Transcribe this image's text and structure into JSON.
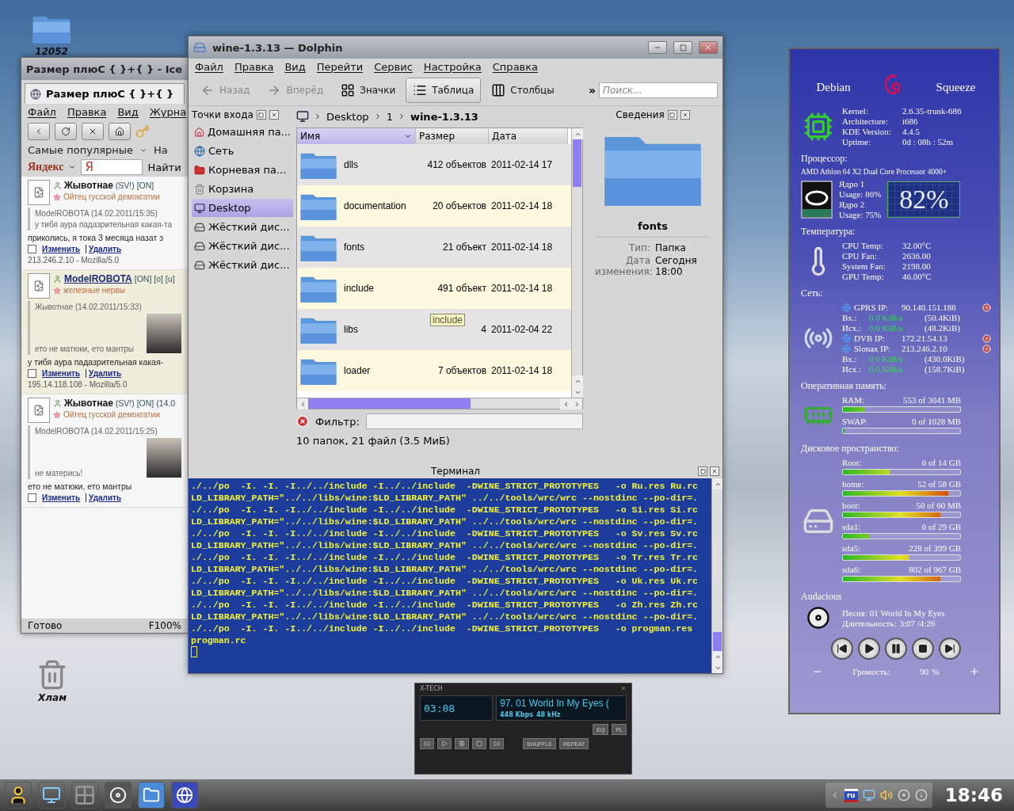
{
  "desktop_folder": {
    "label": "12052"
  },
  "desktop_trash": {
    "label": "Хлам"
  },
  "browser": {
    "title": "Размер плюС { }+{ } - Ice",
    "tab": "Размер плюС { }+{ }",
    "menu": [
      "Файл",
      "Правка",
      "Вид",
      "Журна"
    ],
    "bookmarks": [
      "Самые популярные",
      "На"
    ],
    "search_engine": "Яндекс",
    "search_value": "Я",
    "search_button": "Найти",
    "status": "Готово",
    "zoom": "F100%",
    "posts": [
      {
        "author": "Жывотнае",
        "tags": "(SV!) [ON]",
        "rank": "Ойтец гусской демокгатии",
        "quote_author": "ModelROBOTA (14.02.2011/15:35)",
        "quote_text": "у тибя аура падазрительная какая-та",
        "has_photo": false,
        "highlighted": false,
        "message": "приколись, я тока 3 месяца назат з",
        "links": [
          "Изменить",
          "Удалить"
        ],
        "meta": "213.246.2.10 - Mozilla/5.0"
      },
      {
        "author": "ModelROBOTA",
        "tags": "[ON] [o] [u]",
        "rank": "железные нервы",
        "quote_author": "Жывотнае (14.02.2011/15:33)",
        "quote_text": "ето не матюки, ето мантры",
        "has_photo": true,
        "highlighted": true,
        "message": "у тибя аура падазрительная какая-",
        "links": [
          "Изменить",
          "Удалить"
        ],
        "meta": "195.14.118.108 - Mozilla/5.0"
      },
      {
        "author": "Жывотнае",
        "tags": "(SV!) [ON] (14.0",
        "rank": "Ойтец гусской демокгатии",
        "quote_author": "ModelROBOTA (14.02.2011/15:25)",
        "quote_text": "не матерись!",
        "has_photo": true,
        "highlighted": false,
        "message": "ето не матюки, ето мантры",
        "links": [
          "Изменить",
          "Удалить"
        ]
      }
    ]
  },
  "dolphin": {
    "title": "wine-1.3.13 — Dolphin",
    "menu": [
      "Файл",
      "Правка",
      "Вид",
      "Перейти",
      "Сервис",
      "Настройка",
      "Справка"
    ],
    "toolbar": [
      {
        "label": "Назад",
        "kind": "back",
        "disabled": true,
        "selected": false
      },
      {
        "label": "Вперёд",
        "kind": "forward",
        "disabled": true,
        "selected": false
      },
      {
        "label": "Значки",
        "kind": "icons",
        "disabled": false,
        "selected": false
      },
      {
        "label": "Таблица",
        "kind": "details",
        "disabled": false,
        "selected": true
      },
      {
        "label": "Столбцы",
        "kind": "columns",
        "disabled": false,
        "selected": false
      }
    ],
    "more": "»",
    "search_placeholder": "Поиск...",
    "places_title": "Точки входа",
    "places": [
      {
        "label": "Домашняя па...",
        "kind": "home",
        "selected": false
      },
      {
        "label": "Сеть",
        "kind": "network",
        "selected": false
      },
      {
        "label": "Корневая па...",
        "kind": "root",
        "selected": false
      },
      {
        "label": "Корзина",
        "kind": "trash",
        "selected": false
      },
      {
        "label": "Desktop",
        "kind": "desktop",
        "selected": true
      },
      {
        "label": "Жёсткий дис...",
        "kind": "disk",
        "selected": false
      },
      {
        "label": "Жёсткий дис...",
        "kind": "disk",
        "selected": false
      },
      {
        "label": "Жёсткий дис...",
        "kind": "disk",
        "selected": false
      }
    ],
    "breadcrumb": [
      "Desktop",
      "1",
      "wine-1.3.13"
    ],
    "columns": [
      "Имя",
      "Размер",
      "Дата"
    ],
    "rows": [
      {
        "name": "dlls",
        "size": "412 объектов",
        "date": "2011-02-14 17"
      },
      {
        "name": "documentation",
        "size": "20 объектов",
        "date": "2011-02-14 18"
      },
      {
        "name": "fonts",
        "size": "21 объект",
        "date": "2011-02-14 18"
      },
      {
        "name": "include",
        "size": "491 объект",
        "date": "2011-02-14 18"
      },
      {
        "name": "libs",
        "size": "4",
        "date": "2011-02-04 22"
      },
      {
        "name": "loader",
        "size": "7 объектов",
        "date": "2011-02-14 18"
      }
    ],
    "tooltip": "include",
    "filter_label": "Фильтр:",
    "status": "10 папок, 21 файл (3.5 МиБ)",
    "info_title": "Сведения",
    "info_name": "fonts",
    "info_fields": [
      {
        "label": "Тип:",
        "value": "Папка"
      },
      {
        "label": "Дата изменения:",
        "value": "Сегодня 18:00"
      }
    ]
  },
  "terminal": {
    "title": "Терминал",
    "lines": [
      "./../po  -I. -I. -I../../include -I../../include  -DWINE_STRICT_PROTOTYPES   -o Ru.res Ru.rc",
      "LD_LIBRARY_PATH=\"../../libs/wine:$LD_LIBRARY_PATH\" ../../tools/wrc/wrc --nostdinc --po-dir=.",
      "./../po  -I. -I. -I../../include -I../../include  -DWINE_STRICT_PROTOTYPES   -o Si.res Si.rc",
      "LD_LIBRARY_PATH=\"../../libs/wine:$LD_LIBRARY_PATH\" ../../tools/wrc/wrc --nostdinc --po-dir=.",
      "./../po  -I. -I. -I../../include -I../../include  -DWINE_STRICT_PROTOTYPES   -o Sv.res Sv.rc",
      "LD_LIBRARY_PATH=\"../../libs/wine:$LD_LIBRARY_PATH\" ../../tools/wrc/wrc --nostdinc --po-dir=.",
      "./../po  -I. -I. -I../../include -I../../include  -DWINE_STRICT_PROTOTYPES   -o Tr.res Tr.rc",
      "LD_LIBRARY_PATH=\"../../libs/wine:$LD_LIBRARY_PATH\" ../../tools/wrc/wrc --nostdinc --po-dir=.",
      "./../po  -I. -I. -I../../include -I../../include  -DWINE_STRICT_PROTOTYPES   -o Uk.res Uk.rc",
      "LD_LIBRARY_PATH=\"../../libs/wine:$LD_LIBRARY_PATH\" ../../tools/wrc/wrc --nostdinc --po-dir=.",
      "./../po  -I. -I. -I../../include -I../../include  -DWINE_STRICT_PROTOTYPES   -o Zh.res Zh.rc",
      "LD_LIBRARY_PATH=\"../../libs/wine:$LD_LIBRARY_PATH\" ../../tools/wrc/wrc --nostdinc --po-dir=.",
      "./../po  -I. -I. -I../../include -I../../include  -DWINE_STRICT_PROTOTYPES   -o progman.res",
      "progman.rc"
    ]
  },
  "sysmon": {
    "distro": "Debian",
    "release": "Squeeze",
    "system": [
      {
        "label": "Kernel:",
        "value": "2.6.35-trunk-686"
      },
      {
        "label": "Architecture:",
        "value": "i686"
      },
      {
        "label": "KDE Version:",
        "value": "4.4.5"
      },
      {
        "label": "Uptime:",
        "value": "0d : 08h : 52m"
      }
    ],
    "cpu_heading": "Процессор:",
    "cpu_model": "AMD Athlon 64 X2 Dual Core Processor 4000+",
    "cores": [
      {
        "name": "Ядро 1",
        "usage": "Usage: 86%"
      },
      {
        "name": "Ядро 2",
        "usage": "Usage: 75%"
      }
    ],
    "cpu_total": "82%",
    "temp_heading": "Температура:",
    "sensors": [
      {
        "label": "CPU Temp:",
        "value": "32.00°C"
      },
      {
        "label": "CPU Fan:",
        "value": "2636.00"
      },
      {
        "label": "System Fan:",
        "value": "2198.00"
      },
      {
        "label": "GPU Temp:",
        "value": "46.00°C"
      }
    ],
    "net_heading": "Сеть:",
    "net": [
      {
        "kind": "ip",
        "label": "GPRS IP:",
        "value": "90.140.151.188"
      },
      {
        "kind": "traffic",
        "label": "Вх.:",
        "rate": "0.0 KiB/s",
        "total": "(50.4KiB)"
      },
      {
        "kind": "traffic",
        "label": "Исх.:",
        "rate": "0.0 KiB/s",
        "total": "(48.2KiB)"
      },
      {
        "kind": "ip",
        "label": "DVB IP:",
        "value": "172.21.54.13"
      },
      {
        "kind": "ip",
        "label": "Slonax IP:",
        "value": "213.246.2.10"
      },
      {
        "kind": "traffic",
        "label": "Вх.:",
        "rate": "0.0 KiB/s",
        "total": "(430.0KiB)"
      },
      {
        "kind": "traffic",
        "label": "Исх.:",
        "rate": "0.0 KiB/s",
        "total": "(158.7KiB)"
      }
    ],
    "mem_heading": "Оперативная память:",
    "memory": [
      {
        "label": "RAM:",
        "value": "553 of 3041 MB",
        "level": 0.18
      },
      {
        "label": "SWAP:",
        "value": "0 of 1028 MB",
        "level": 0
      }
    ],
    "disk_heading": "Дисковое пространство:",
    "disks": [
      {
        "label": "Root:",
        "value": "6 of 14 GB",
        "level": 0.4
      },
      {
        "label": "home:",
        "value": "52 of 58 GB",
        "level": 0.9
      },
      {
        "label": "boot:",
        "value": "50 of 60 MB",
        "level": 0.83
      },
      {
        "label": "sda1:",
        "value": "6 of 29 GB",
        "level": 0.22
      },
      {
        "label": "sda5:",
        "value": "228 of 399 GB",
        "level": 0.57
      },
      {
        "label": "sda6:",
        "value": "802 of 967 GB",
        "level": 0.83
      }
    ],
    "player_heading": "Audacious",
    "song": "Песня: 01 World In My Eyes",
    "duration_label": "Длительность:",
    "duration": "3:07 /4:26",
    "volume_label": "Громость:",
    "volume": "90",
    "volume_unit": "%"
  },
  "xmms": {
    "title": "X-TECH",
    "time": "03:08",
    "track": "97. 01 World In My Eyes (",
    "bitrate": "448 Kbps",
    "samplerate": "48 kHz",
    "eq": "EQ",
    "pl": "PL",
    "shuffle": "SHUFFLE",
    "repeat": "REPEAT"
  },
  "taskbar": {
    "layout": "ru",
    "clock": "18:46"
  }
}
